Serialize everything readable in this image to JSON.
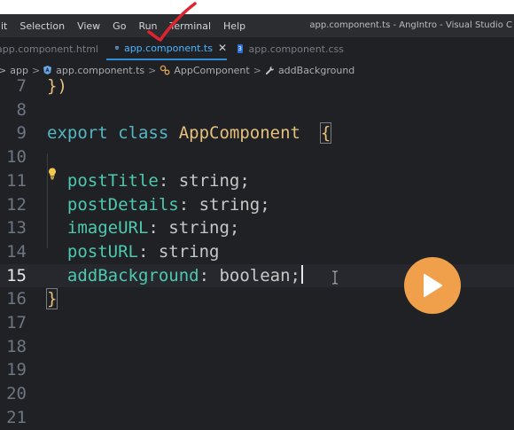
{
  "menu": {
    "items": [
      "dit",
      "Selection",
      "View",
      "Go",
      "Run",
      "Terminal",
      "Help"
    ]
  },
  "window": {
    "title": "app.component.ts - AngIntro - Visual Studio C"
  },
  "tabs": [
    {
      "label": "app.component.html",
      "active": false
    },
    {
      "label": "app.component.ts",
      "active": true
    },
    {
      "label": "app.component.css",
      "active": false
    }
  ],
  "breadcrumb": {
    "items": [
      "app",
      "app.component.ts",
      "AppComponent",
      "addBackground"
    ]
  },
  "editor": {
    "lines": [
      {
        "num": "7",
        "code": "})"
      },
      {
        "num": "8",
        "code": ""
      },
      {
        "num": "9",
        "code": "export class AppComponent  {"
      },
      {
        "num": "10",
        "code": ""
      },
      {
        "num": "11",
        "code": "  postTitle: string;"
      },
      {
        "num": "12",
        "code": "  postDetails: string;"
      },
      {
        "num": "13",
        "code": "  imageURL: string;"
      },
      {
        "num": "14",
        "code": "  postURL: string"
      },
      {
        "num": "15",
        "code": "  addBackground: boolean;"
      },
      {
        "num": "16",
        "code": "}"
      },
      {
        "num": "17",
        "code": ""
      },
      {
        "num": "18",
        "code": ""
      },
      {
        "num": "19",
        "code": ""
      },
      {
        "num": "20",
        "code": ""
      },
      {
        "num": "21",
        "code": ""
      }
    ],
    "current_line": "15"
  },
  "colors": {
    "accent_tab": "#4fb4ff",
    "keyword": "#56b6c2",
    "class_name": "#e5c07b",
    "property": "#4ec9b0",
    "play_button": "#f0a04b",
    "annotation": "#e0242f"
  },
  "icons": {
    "play": "play-icon",
    "lightbulb": "lightbulb-icon",
    "angular": "angular-icon",
    "css": "css-file-icon"
  }
}
